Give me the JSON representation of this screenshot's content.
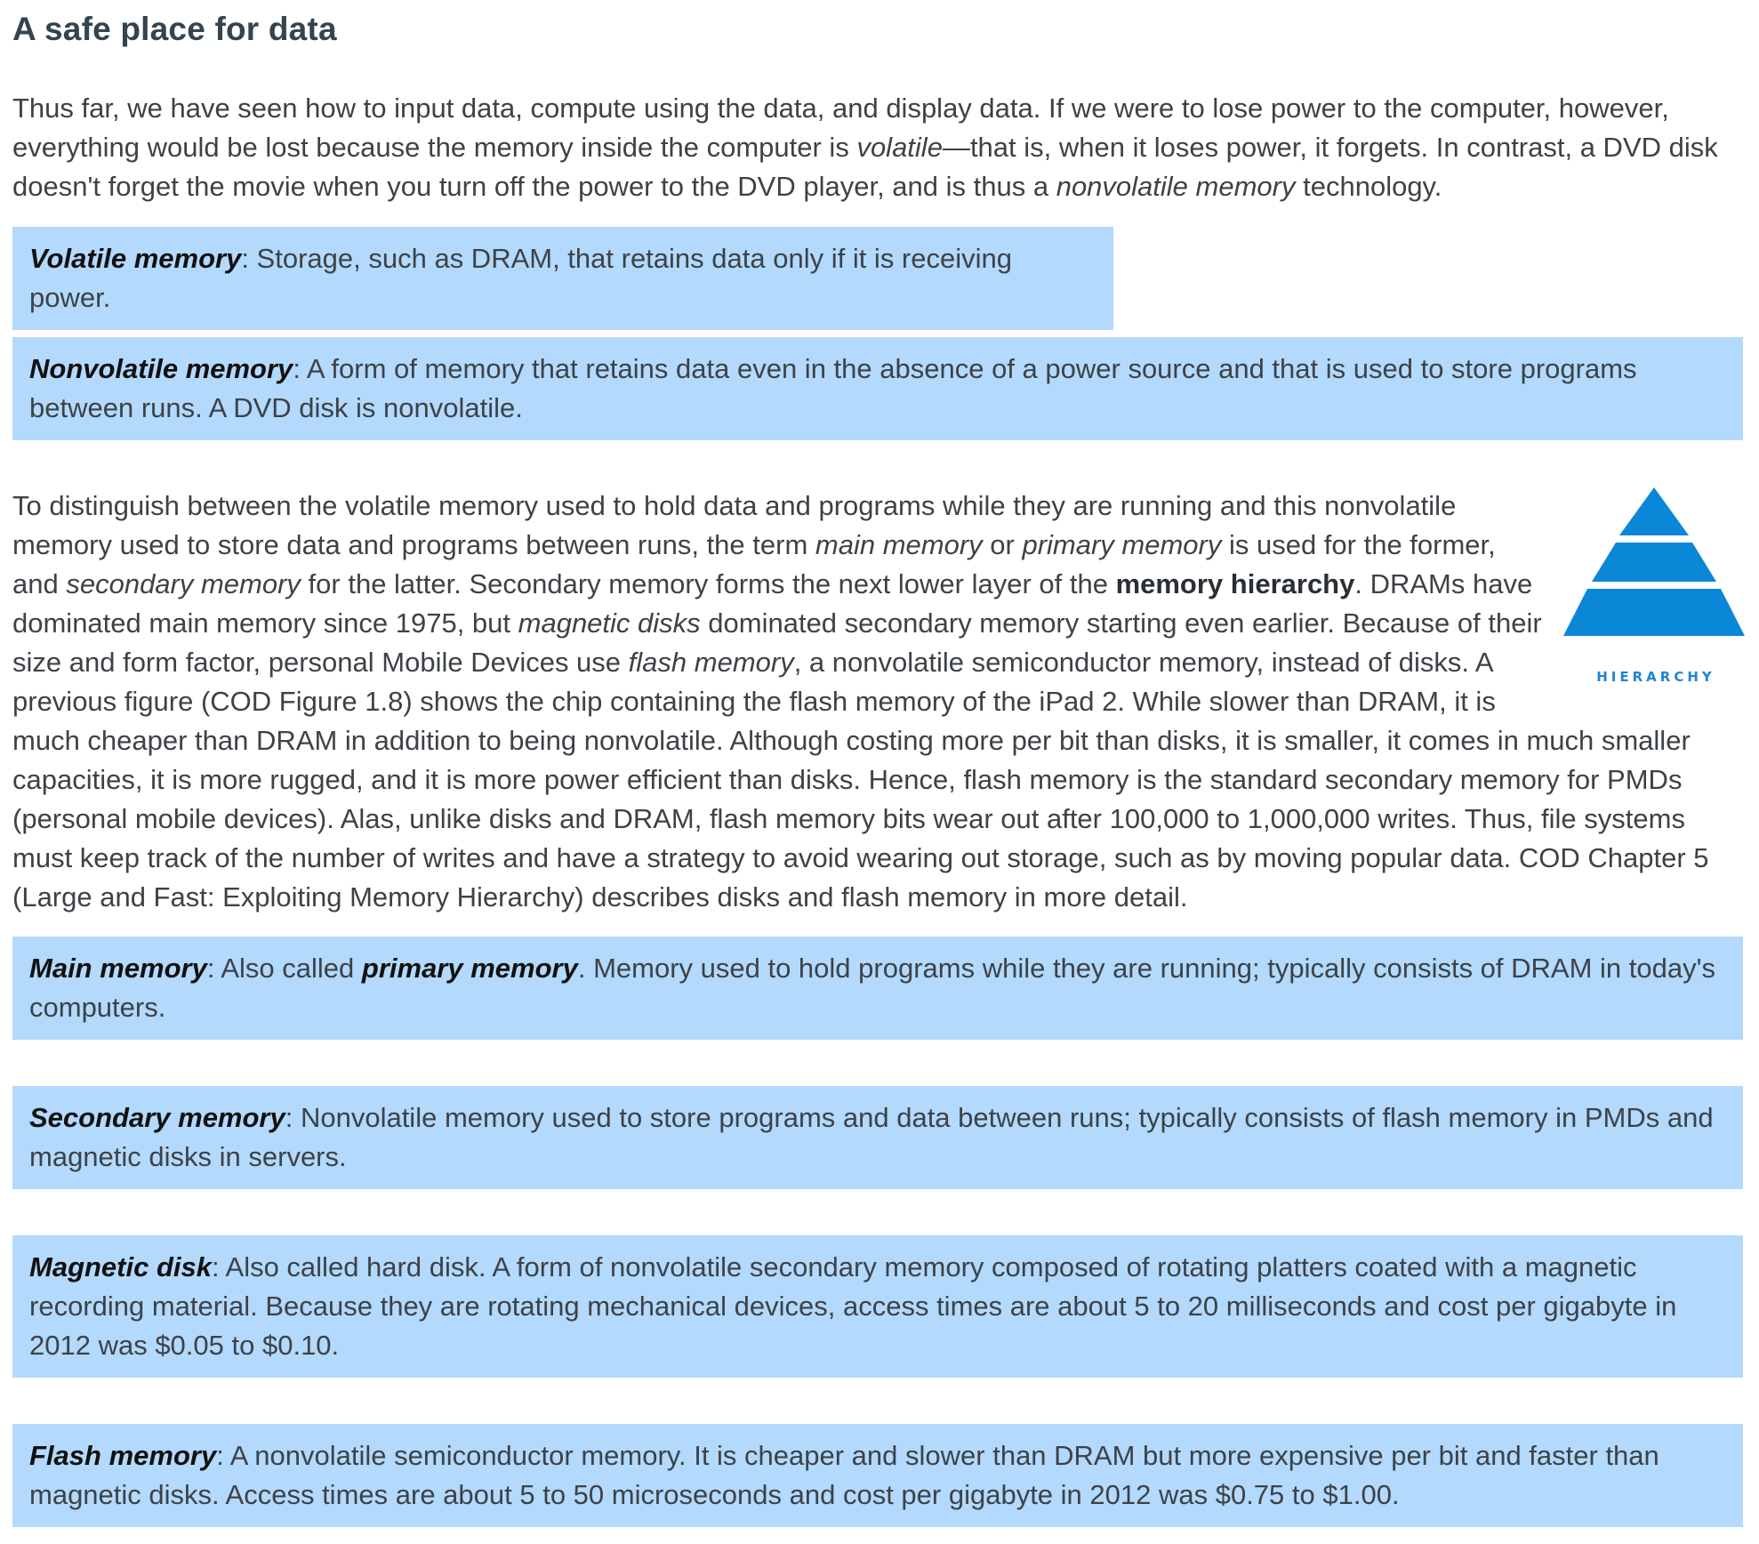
{
  "heading": "A safe place for data",
  "intro": {
    "p1": "Thus far, we have seen how to input data, compute using the data, and display data. If we were to lose power to the computer, however, everything would be lost because the memory inside the computer is ",
    "em1": "volatile",
    "p2": "—that is, when it loses power, it forgets. In contrast, a DVD disk doesn't forget the movie when you turn off the power to the DVD player, and is thus a ",
    "em2": "nonvolatile memory",
    "p3": " technology."
  },
  "definitions": {
    "volatile": {
      "term": "Volatile memory",
      "text": ": Storage, such as DRAM, that retains data only if it is receiving power."
    },
    "nonvolatile": {
      "term": "Nonvolatile memory",
      "text": ": A form of memory that retains data even in the absence of a power source and that is used to store programs between runs. A DVD disk is nonvolatile."
    },
    "main": {
      "term": "Main memory",
      "text_a": ": Also called ",
      "term2": "primary memory",
      "text_b": ". Memory used to hold programs while they are running; typically consists of DRAM in today's computers."
    },
    "secondary": {
      "term": "Secondary memory",
      "text": ": Nonvolatile memory used to store programs and data between runs; typically consists of flash memory in PMDs and magnetic disks in servers."
    },
    "magnetic": {
      "term": "Magnetic disk",
      "text": ": Also called hard disk. A form of nonvolatile secondary memory composed of rotating platters coated with a magnetic recording material. Because they are rotating mechanical devices, access times are about 5 to 20 milliseconds and cost per gigabyte in 2012 was $0.05 to $0.10."
    },
    "flash": {
      "term": "Flash memory",
      "text": ": A nonvolatile semiconductor memory. It is cheaper and slower than DRAM but more expensive per bit and faster than magnetic disks. Access times are about 5 to 50 microseconds and cost per gigabyte in 2012 was $0.75 to $1.00."
    }
  },
  "body": {
    "t1": "To distinguish between the volatile memory used to hold data and programs while they are running and this nonvolatile memory used to store data and programs between runs, the term ",
    "em1": "main memory",
    "t2": " or ",
    "em2": "primary memory",
    "t3": " is used for the former, and ",
    "em3": "secondary memory",
    "t4": " for the latter. Secondary memory forms the next lower layer of the ",
    "strong1": "memory hierarchy",
    "t5": ". DRAMs have dominated main memory since 1975, but ",
    "em4": "magnetic disks",
    "t6": " dominated secondary memory starting even earlier. Because of their size and form factor, personal Mobile Devices use ",
    "em5": "flash memory",
    "t7": ", a nonvolatile semiconductor memory, instead of disks. A previous figure (COD Figure 1.8) shows the chip containing the flash memory of the iPad 2. While slower than DRAM, it is much cheaper than DRAM in addition to being nonvolatile. Although costing more per bit than disks, it is smaller, it comes in much smaller capacities, it is more rugged, and it is more power efficient than disks. Hence, flash memory is the standard secondary memory for PMDs (personal mobile devices). Alas, unlike disks and DRAM, flash memory bits wear out after 100,000 to 1,000,000 writes. Thus, file systems must keep track of the number of writes and have a strategy to avoid wearing out storage, such as by moving popular data. COD Chapter 5 (Large and Fast: Exploiting Memory Hierarchy) describes disks and flash memory in more detail."
  },
  "figure": {
    "icon": "hierarchy-pyramid-icon",
    "label": "HIERARCHY",
    "color": "#0b87d8"
  },
  "colors": {
    "definition_background": "#b3d9fc",
    "heading": "#34444f",
    "body_text": "#3d4247"
  }
}
